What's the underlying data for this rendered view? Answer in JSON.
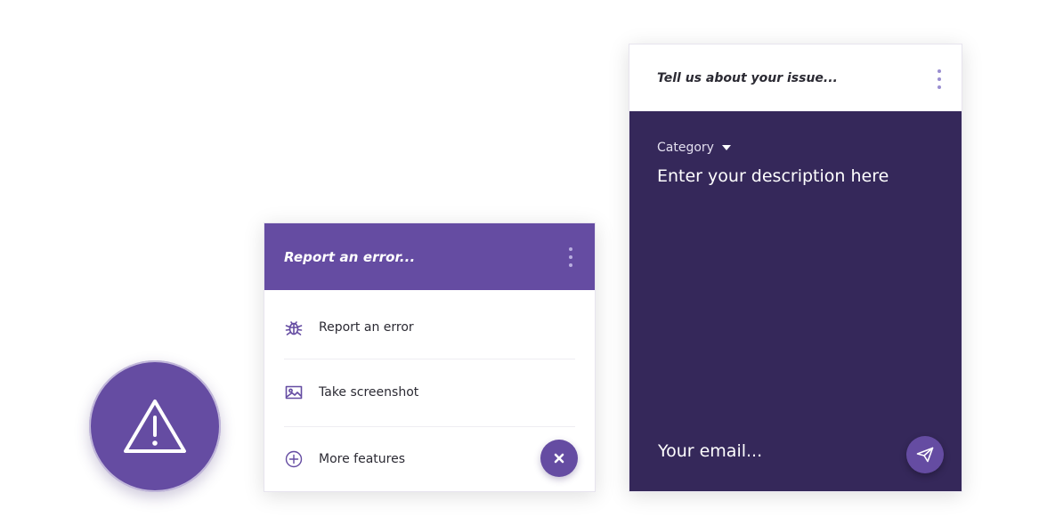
{
  "colors": {
    "primary": "#654ca2",
    "dark_panel": "#35285a",
    "text_dark": "#2b2a33",
    "white": "#ffffff"
  },
  "warning_fab": {
    "icon": "warning-triangle-icon"
  },
  "menu_card": {
    "title": "Report an error...",
    "menu_icon": "more-vertical-icon",
    "items": [
      {
        "label": "Report an error",
        "icon": "bug-icon"
      },
      {
        "label": "Take screenshot",
        "icon": "image-icon"
      },
      {
        "label": "More features",
        "icon": "plus-circle-icon"
      }
    ],
    "close_icon": "close-icon"
  },
  "issue_card": {
    "title": "Tell us about your issue...",
    "menu_icon": "more-vertical-icon",
    "category_label": "Category",
    "description_placeholder": "Enter your description here",
    "email_placeholder": "Your email...",
    "send_icon": "send-icon"
  }
}
